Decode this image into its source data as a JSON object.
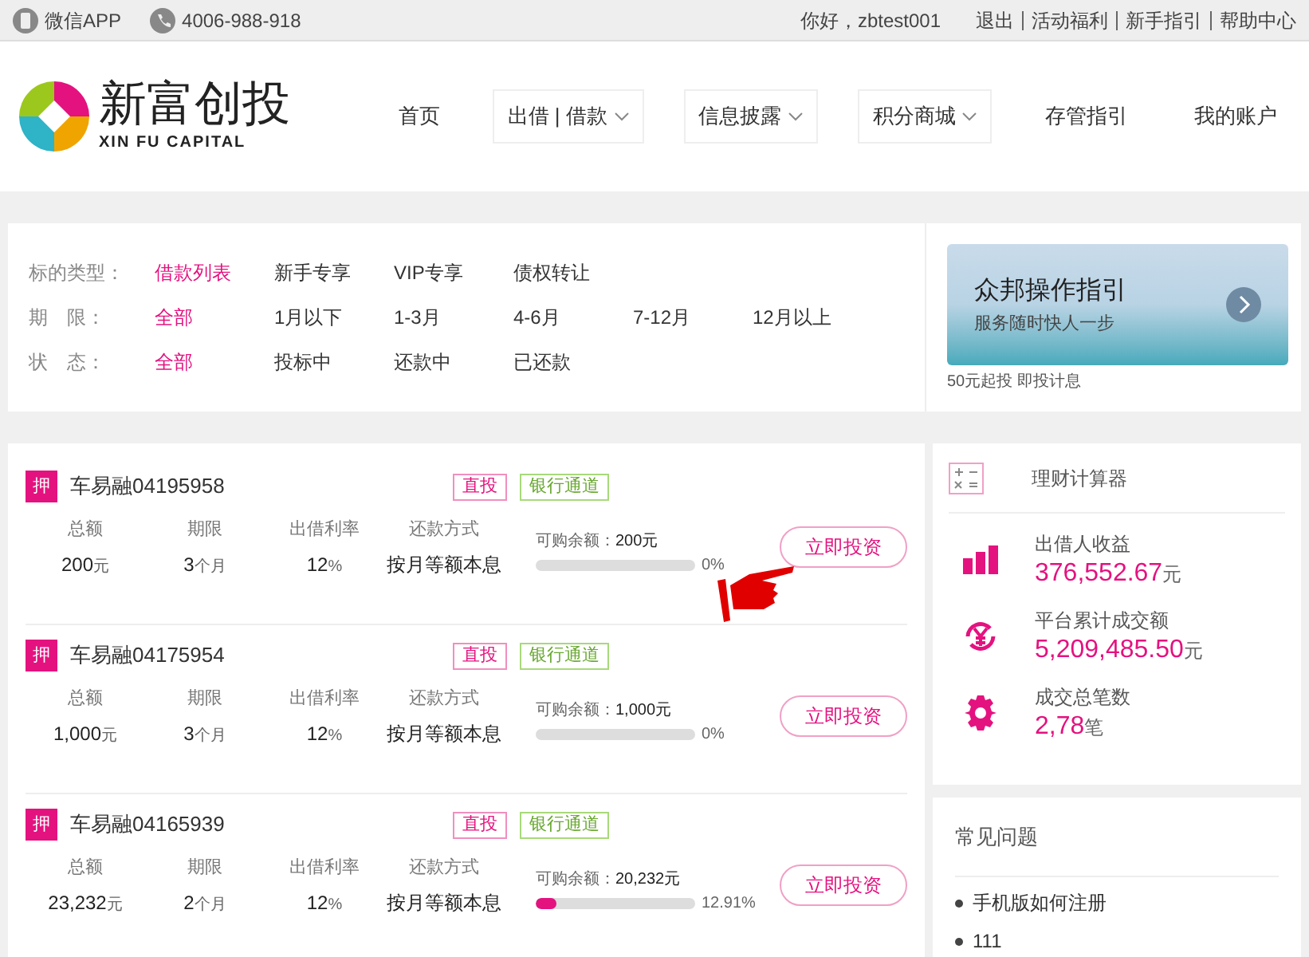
{
  "top_bar": {
    "app_link": "微信APP",
    "phone": "4006-988-918",
    "greeting": "你好，zbtest001",
    "links": [
      "退出",
      "活动福利",
      "新手指引",
      "帮助中心"
    ]
  },
  "header": {
    "logo_name": "新富创投",
    "logo_sub": "XIN FU CAPITAL",
    "nav": [
      {
        "label": "首页",
        "has_menu": false
      },
      {
        "label": "出借 | 借款",
        "has_menu": true
      },
      {
        "label": "信息披露",
        "has_menu": true
      },
      {
        "label": "积分商城",
        "has_menu": true
      },
      {
        "label": "存管指引",
        "has_menu": false
      },
      {
        "label": "我的账户",
        "has_menu": false
      }
    ]
  },
  "filters": [
    {
      "label": "标的类型：",
      "options": [
        {
          "label": "借款列表",
          "selected": true
        },
        {
          "label": "新手专享",
          "selected": false
        },
        {
          "label": "VIP专享",
          "selected": false
        },
        {
          "label": "债权转让",
          "selected": false
        }
      ]
    },
    {
      "label": "期　限：",
      "options": [
        {
          "label": "全部",
          "selected": true
        },
        {
          "label": "1月以下",
          "selected": false
        },
        {
          "label": "1-3月",
          "selected": false
        },
        {
          "label": "4-6月",
          "selected": false
        },
        {
          "label": "7-12月",
          "selected": false
        },
        {
          "label": "12月以上",
          "selected": false
        }
      ]
    },
    {
      "label": "状　态：",
      "options": [
        {
          "label": "全部",
          "selected": true
        },
        {
          "label": "投标中",
          "selected": false
        },
        {
          "label": "还款中",
          "selected": false
        },
        {
          "label": "已还款",
          "selected": false
        }
      ]
    }
  ],
  "banner": {
    "title": "众邦操作指引",
    "subtitle": "服务随时快人一步",
    "caption": "50元起投 即投计息"
  },
  "loans": [
    {
      "badge": "押",
      "name": "车易融04195958",
      "tags": [
        "直投",
        "银行通道"
      ],
      "columns": [
        {
          "label": "总额",
          "value": "200",
          "unit": "元"
        },
        {
          "label": "期限",
          "value": "3",
          "unit": "个月"
        },
        {
          "label": "出借利率",
          "value": "12",
          "unit": "%"
        },
        {
          "label": "还款方式",
          "value": "按月等额本息"
        }
      ],
      "remaining_label": "可购余额：",
      "remaining": "200元",
      "level": 0,
      "percent": "0%",
      "button": "立即投资",
      "pointer": true
    },
    {
      "badge": "押",
      "name": "车易融04175954",
      "tags": [
        "直投",
        "银行通道"
      ],
      "columns": [
        {
          "label": "总额",
          "value": "1,000",
          "unit": "元"
        },
        {
          "label": "期限",
          "value": "3",
          "unit": "个月"
        },
        {
          "label": "出借利率",
          "value": "12",
          "unit": "%"
        },
        {
          "label": "还款方式",
          "value": "按月等额本息"
        }
      ],
      "remaining_label": "可购余额：",
      "remaining": "1,000元",
      "level": 0,
      "percent": "0%",
      "button": "立即投资",
      "pointer": false
    },
    {
      "badge": "押",
      "name": "车易融04165939",
      "tags": [
        "直投",
        "银行通道"
      ],
      "columns": [
        {
          "label": "总额",
          "value": "23,232",
          "unit": "元"
        },
        {
          "label": "期限",
          "value": "2",
          "unit": "个月"
        },
        {
          "label": "出借利率",
          "value": "12",
          "unit": "%"
        },
        {
          "label": "还款方式",
          "value": "按月等额本息"
        }
      ],
      "remaining_label": "可购余额：",
      "remaining": "20,232元",
      "level": 0.1291,
      "percent": "12.91%",
      "button": "立即投资",
      "pointer": false
    }
  ],
  "sidebar": {
    "calculator": "理财计算器",
    "stats": [
      {
        "kind": "bars",
        "label": "出借人收益",
        "value": "376,552.67",
        "unit": "元"
      },
      {
        "kind": "yuan",
        "label": "平台累计成交额",
        "value": "5,209,485.50",
        "unit": "元"
      },
      {
        "kind": "gear",
        "label": "成交总笔数",
        "value": "2,78",
        "unit": "笔"
      }
    ],
    "faq_title": "常见问题",
    "faq": [
      "手机版如何注册",
      "111"
    ]
  }
}
